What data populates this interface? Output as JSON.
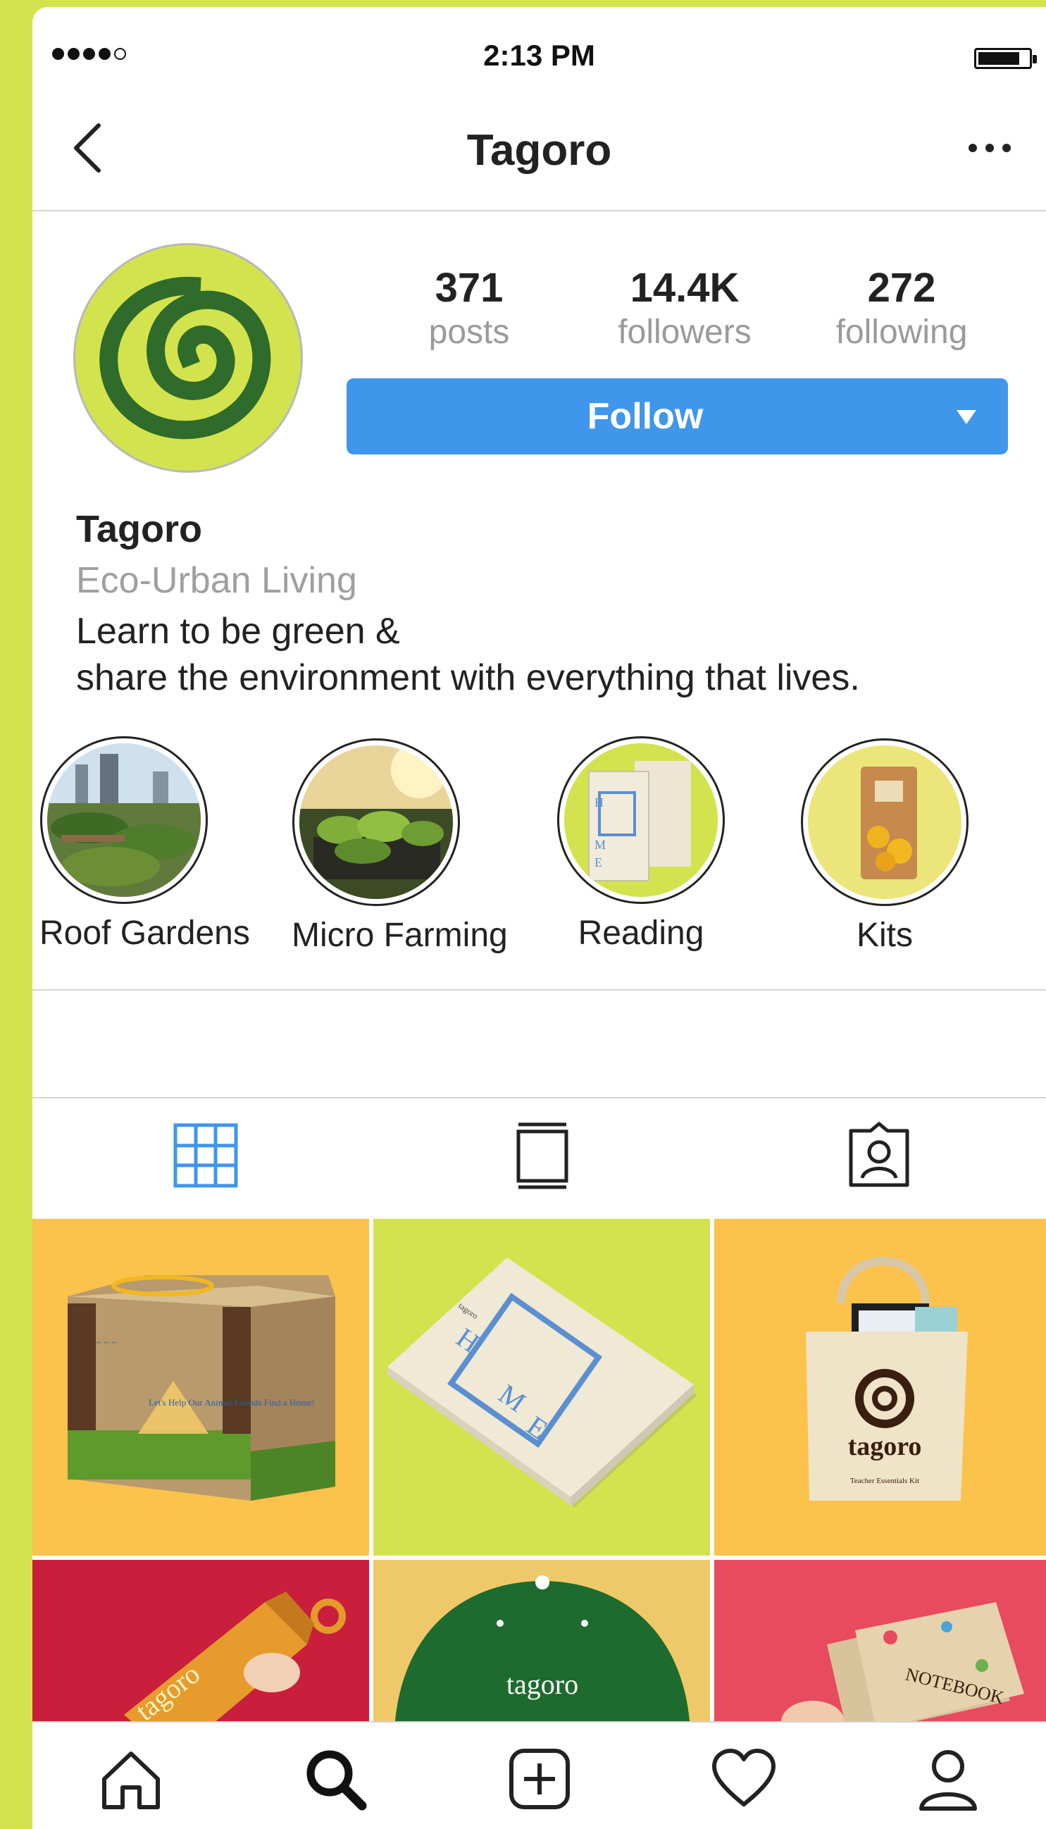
{
  "status_bar": {
    "time": "2:13 PM"
  },
  "nav": {
    "title": "Tagoro"
  },
  "profile": {
    "stats": [
      {
        "value": "371",
        "label": "posts"
      },
      {
        "value": "14.4K",
        "label": "followers"
      },
      {
        "value": "272",
        "label": "following"
      }
    ],
    "follow_label": "Follow",
    "name": "Tagoro",
    "category": "Eco-Urban Living",
    "bio_lines": [
      "Learn to be green &",
      "share the environment with everything that lives."
    ]
  },
  "highlights": [
    {
      "label": "Roof Gardens"
    },
    {
      "label": "Micro Farming"
    },
    {
      "label": "Reading"
    },
    {
      "label": "Kits"
    }
  ],
  "posts": [
    {
      "text": "Let's Help Our Animal Friends Find a Home!"
    },
    {
      "text": "tagoro"
    },
    {
      "text": "tagoro",
      "sub": "Teacher Essentials Kit"
    },
    {
      "text": "tagoro"
    },
    {
      "text": "tagoro"
    },
    {
      "text": "NOTEBOOK"
    }
  ],
  "colors": {
    "brand_lime": "#d3e34e",
    "brand_green": "#2f6b2a",
    "follow_blue": "#3f96ea"
  }
}
